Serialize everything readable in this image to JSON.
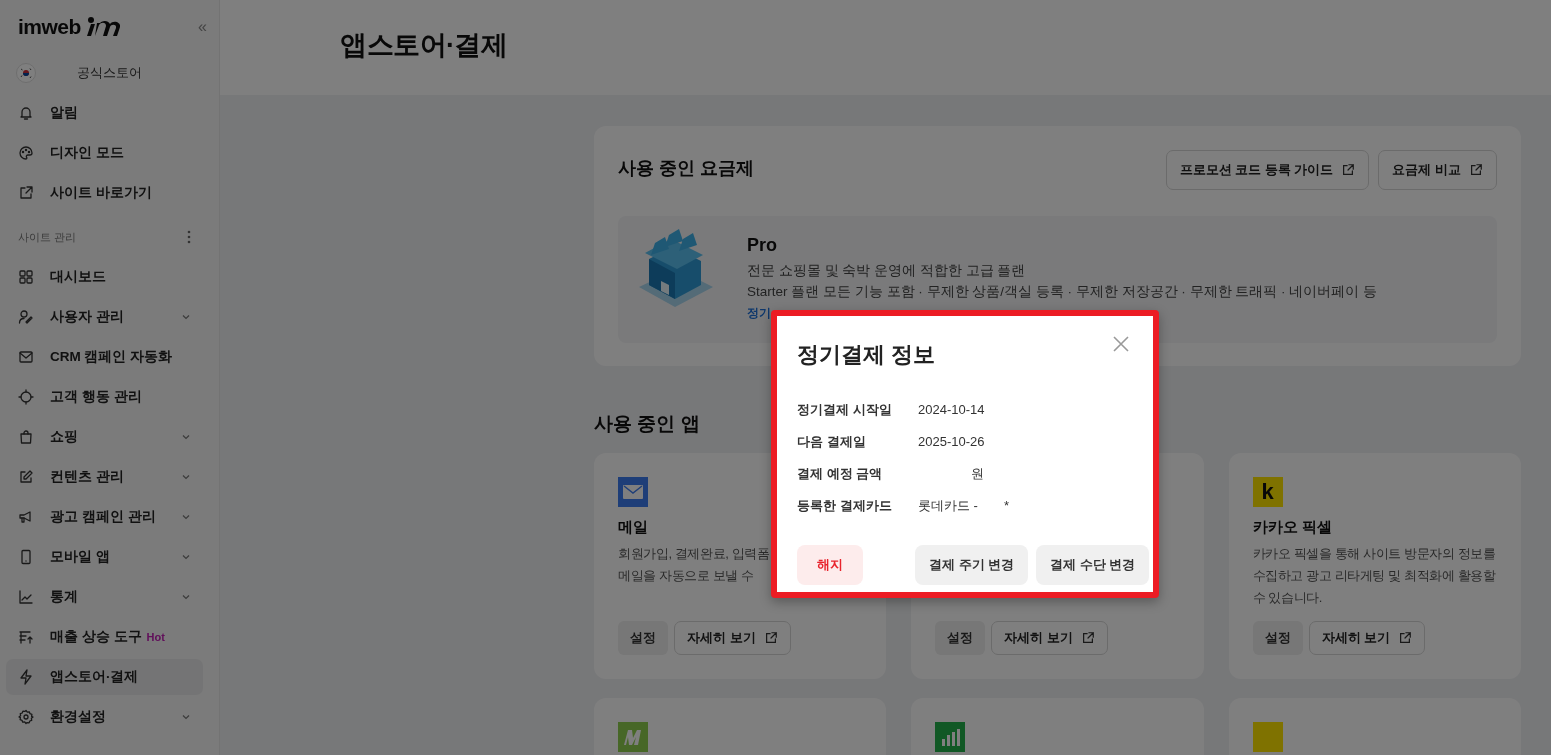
{
  "sidebar": {
    "logo": "imweb",
    "collapse": "«",
    "site": {
      "name": "공식스토어"
    },
    "top_items": [
      {
        "label": "알림"
      },
      {
        "label": "디자인 모드"
      },
      {
        "label": "사이트 바로가기"
      }
    ],
    "section": {
      "title": "사이트 관리"
    },
    "items": [
      {
        "label": "대시보드",
        "expandable": false,
        "selected": false
      },
      {
        "label": "사용자 관리",
        "expandable": true,
        "selected": false
      },
      {
        "label": "CRM 캠페인 자동화",
        "expandable": false,
        "selected": false
      },
      {
        "label": "고객 행동 관리",
        "expandable": false,
        "selected": false
      },
      {
        "label": "쇼핑",
        "expandable": true,
        "selected": false
      },
      {
        "label": "컨텐츠 관리",
        "expandable": true,
        "selected": false
      },
      {
        "label": "광고 캠페인 관리",
        "expandable": true,
        "selected": false
      },
      {
        "label": "모바일 앱",
        "expandable": true,
        "selected": false
      },
      {
        "label": "통계",
        "expandable": true,
        "selected": false
      },
      {
        "label": "매출 상승 도구",
        "badge": "Hot",
        "expandable": false,
        "selected": false
      },
      {
        "label": "앱스토어·결제",
        "expandable": false,
        "selected": true
      },
      {
        "label": "환경설정",
        "expandable": true,
        "selected": false
      }
    ]
  },
  "page": {
    "title": "앱스토어·결제"
  },
  "plan": {
    "title": "사용 중인 요금제",
    "buttons": [
      "프로모션 코드 등록 가이드",
      "요금제 비교"
    ],
    "name": "Pro",
    "description": "전문 쇼핑몰 및 숙박 운영에 적합한 고급 플랜",
    "features": "Starter 플랜 모든 기능 포함 · 무제한 상품/객실 등록 · 무제한 저장공간 · 무제한 트래픽 · 네이버페이 등",
    "link": "정기"
  },
  "apps": {
    "title": "사용 중인 앱",
    "cards": [
      {
        "kind": "mail",
        "title": "메일",
        "description": [
          "회원가입, 결제완료, 입력폼",
          "메일을 자동으로 보낼 수"
        ],
        "buttons": [
          "설정",
          "자세히 보기"
        ]
      },
      {
        "buttons": [
          "설정",
          "자세히 보기"
        ]
      },
      {
        "kind": "letter",
        "logo_text": "k",
        "title": "카카오 픽셀",
        "description": [
          "카카오 픽셀을 통해 사이트 방문자의 정보를",
          "수집하고 광고 리타게팅 및 최적화에 활용할",
          "수 있습니다."
        ],
        "buttons": [
          "설정",
          "자세히 보기"
        ]
      },
      {
        "kind": "m"
      },
      {
        "kind": "bars"
      },
      {
        "kind": "plain"
      }
    ]
  },
  "modal": {
    "title": "정기결제 정보",
    "rows": [
      {
        "kind": "date",
        "label": "정기결제 시작일",
        "value": "2024-10-14"
      },
      {
        "kind": "date",
        "label": "다음 결제일",
        "value": "2025-10-26"
      },
      {
        "kind": "amount",
        "label": "결제 예정 금액",
        "value": "원"
      },
      {
        "kind": "card",
        "label": "등록한 결제카드",
        "value": "롯데카드 -",
        "suffix": "*"
      }
    ],
    "buttons": [
      {
        "kind": "danger",
        "label": "해지"
      },
      {
        "kind": "secondary",
        "label": "결제 주기 변경"
      },
      {
        "kind": "secondary",
        "label": "결제 수단 변경"
      }
    ]
  }
}
